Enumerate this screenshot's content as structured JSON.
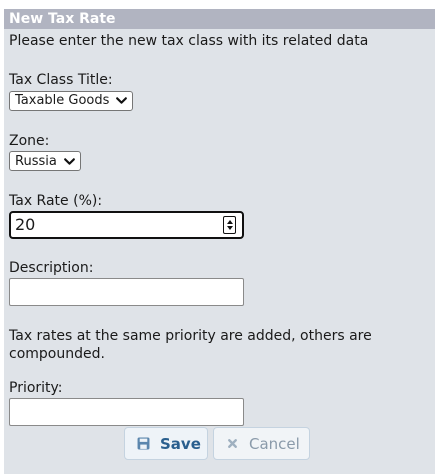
{
  "panel": {
    "title": "New Tax Rate",
    "intro": "Please enter the new tax class with its related data"
  },
  "form": {
    "tax_class": {
      "label": "Tax Class Title:",
      "selected": "Taxable Goods"
    },
    "zone": {
      "label": "Zone:",
      "selected": "Russia"
    },
    "tax_rate": {
      "label": "Tax Rate (%):",
      "value": "20"
    },
    "description": {
      "label": "Description:",
      "value": ""
    },
    "priority_note": "Tax rates at the same priority are added, others are compounded.",
    "priority": {
      "label": "Priority:",
      "value": ""
    }
  },
  "actions": {
    "save_label": "Save",
    "cancel_label": "Cancel"
  },
  "colors": {
    "header_bg": "#b1b4c1",
    "panel_bg": "#dfe3e8",
    "save_text": "#2a5f8e",
    "cancel_text": "#8a9aaa"
  }
}
